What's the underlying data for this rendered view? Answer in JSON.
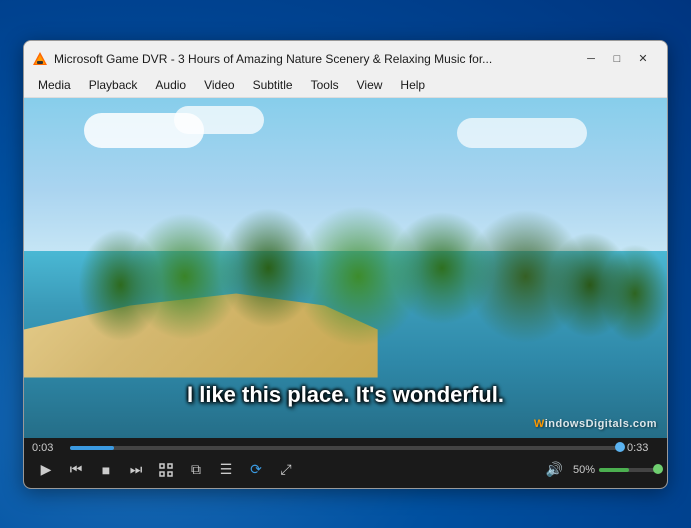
{
  "window": {
    "title": "Microsoft Game DVR - 3 Hours of Amazing Nature Scenery & Relaxing Music for...",
    "icon_color": "#ff6600"
  },
  "title_bar": {
    "minimize_label": "─",
    "maximize_label": "□",
    "close_label": "✕"
  },
  "menu": {
    "items": [
      "Media",
      "Playback",
      "Audio",
      "Video",
      "Subtitle",
      "Tools",
      "View",
      "Help"
    ]
  },
  "video": {
    "subtitle": "I like this place. It's wonderful.",
    "watermark": "WindowsDigitals.com"
  },
  "controls": {
    "time_current": "0:03",
    "time_total": "0:33",
    "progress_percent": 8,
    "volume_percent": 50,
    "volume_label": "50%",
    "buttons": {
      "play": "▶",
      "prev": "⏮",
      "stop": "■",
      "next": "⏭",
      "fullscreen": "⛶",
      "extended": "⧉",
      "playlist": "☰",
      "loop": "⟳",
      "random": "⤢"
    }
  }
}
